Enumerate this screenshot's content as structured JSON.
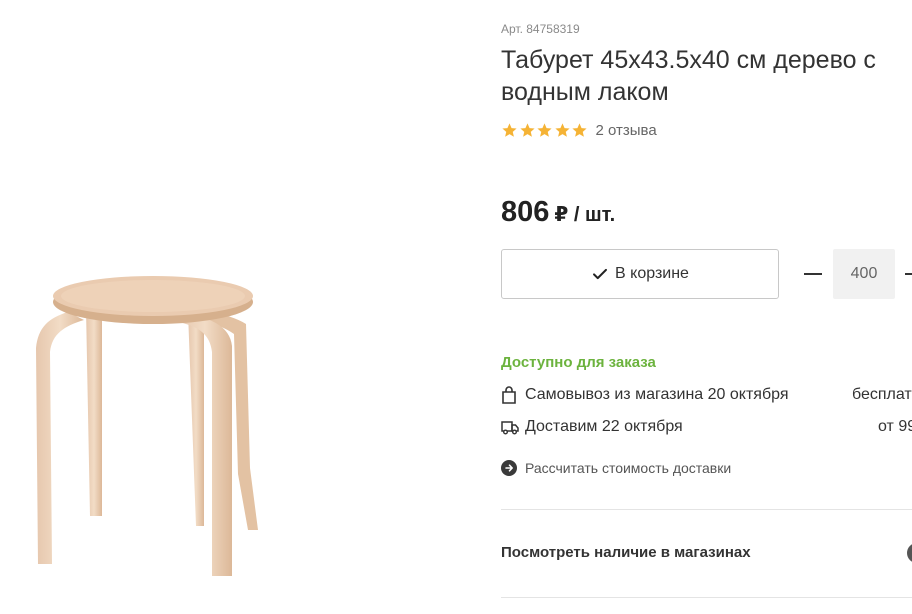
{
  "product": {
    "sku": "Арт. 84758319",
    "title": "Табурет 45x43.5x40 см дерево с водным лаком",
    "rating": 5,
    "reviews": "2 отзыва",
    "price": "806",
    "price_unit": "₽ / шт."
  },
  "cart": {
    "button_label": "В корзине",
    "quantity": "400"
  },
  "availability": {
    "status": "Доступно для заказа",
    "pickup_label": "Самовывоз из магазина 20 октября",
    "pickup_value": "бесплат",
    "delivery_label": "Доставим 22 октября",
    "delivery_value": "от 99",
    "calc_link": "Рассчитать стоимость доставки"
  },
  "stores_link": "Посмотреть наличие в магазинах",
  "colors": {
    "star": "#f5b335",
    "available": "#6cb33e"
  }
}
